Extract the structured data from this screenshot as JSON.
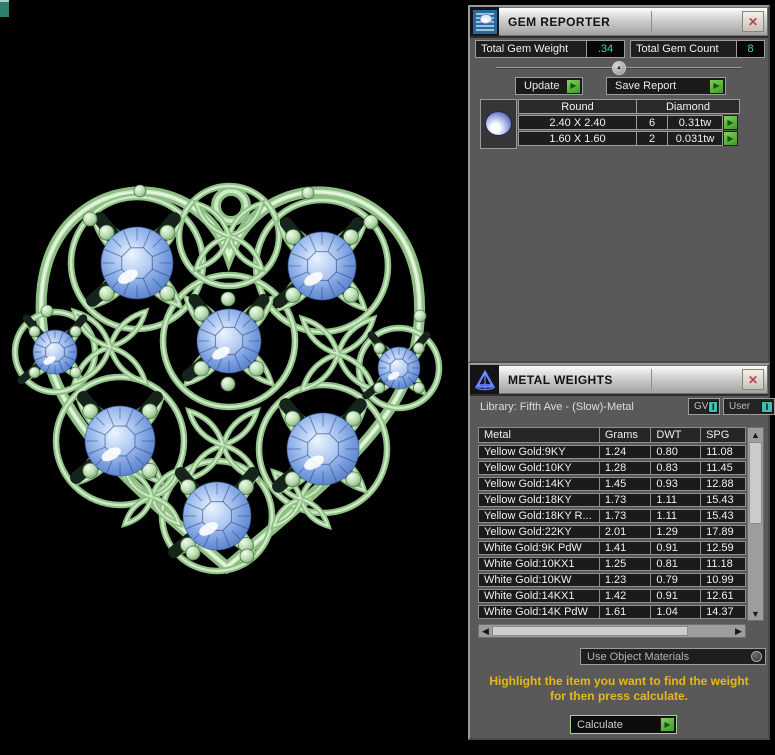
{
  "gem_reporter": {
    "title": "GEM REPORTER",
    "total_gem_weight_label": "Total Gem Weight",
    "total_gem_weight_value": ".34",
    "total_gem_count_label": "Total Gem Count",
    "total_gem_count_value": "8",
    "update_label": "Update",
    "save_report_label": "Save Report",
    "table": {
      "shape_header": "Round",
      "type_header": "Diamond",
      "rows": [
        {
          "size": "2.40 X 2.40",
          "count": "6",
          "weight": "0.31tw"
        },
        {
          "size": "1.60 X 1.60",
          "count": "2",
          "weight": "0.031tw"
        }
      ]
    }
  },
  "metal_weights": {
    "title": "METAL WEIGHTS",
    "library_label": "Library: Fifth Ave - (Slow)-Metal",
    "gv_label": "GV",
    "user_label": "User",
    "indicator_glyph": "I",
    "table": {
      "headers": [
        "Metal",
        "Grams",
        "DWT",
        "SPG"
      ],
      "rows": [
        [
          "Yellow Gold:9KY",
          "1.24",
          "0.80",
          "11.08"
        ],
        [
          "Yellow Gold:10KY",
          "1.28",
          "0.83",
          "11.45"
        ],
        [
          "Yellow Gold:14KY",
          "1.45",
          "0.93",
          "12.88"
        ],
        [
          "Yellow Gold:18KY",
          "1.73",
          "1.11",
          "15.43"
        ],
        [
          "Yellow Gold:18KY R...",
          "1.73",
          "1.11",
          "15.43"
        ],
        [
          "Yellow Gold:22KY",
          "2.01",
          "1.29",
          "17.89"
        ],
        [
          "White Gold:9K PdW",
          "1.41",
          "0.91",
          "12.59"
        ],
        [
          "White Gold:10KX1",
          "1.25",
          "0.81",
          "11.18"
        ],
        [
          "White Gold:10KW",
          "1.23",
          "0.79",
          "10.99"
        ],
        [
          "White Gold:14KX1",
          "1.42",
          "0.91",
          "12.61"
        ],
        [
          "White Gold:14K PdW",
          "1.61",
          "1.04",
          "14.37"
        ]
      ]
    },
    "use_object_materials_label": "Use Object Materials",
    "instruction_line1": "Highlight the item you want to find the weight",
    "instruction_line2": "for then press calculate.",
    "calculate_label": "Calculate"
  },
  "icons": {
    "close": "✕",
    "collapse_up": "▲",
    "go_arrow": "▶",
    "scroll_up": "▲",
    "scroll_down": "▼",
    "scroll_left": "◀",
    "scroll_right": "▶"
  },
  "colors": {
    "accent_teal": "#47d1c1",
    "go_green": "#55b133",
    "warning_yellow": "#e7b71d",
    "metal_green": "#a9d6a0",
    "gem_blue": "#7a9fdf",
    "panel_gray": "#595959"
  }
}
